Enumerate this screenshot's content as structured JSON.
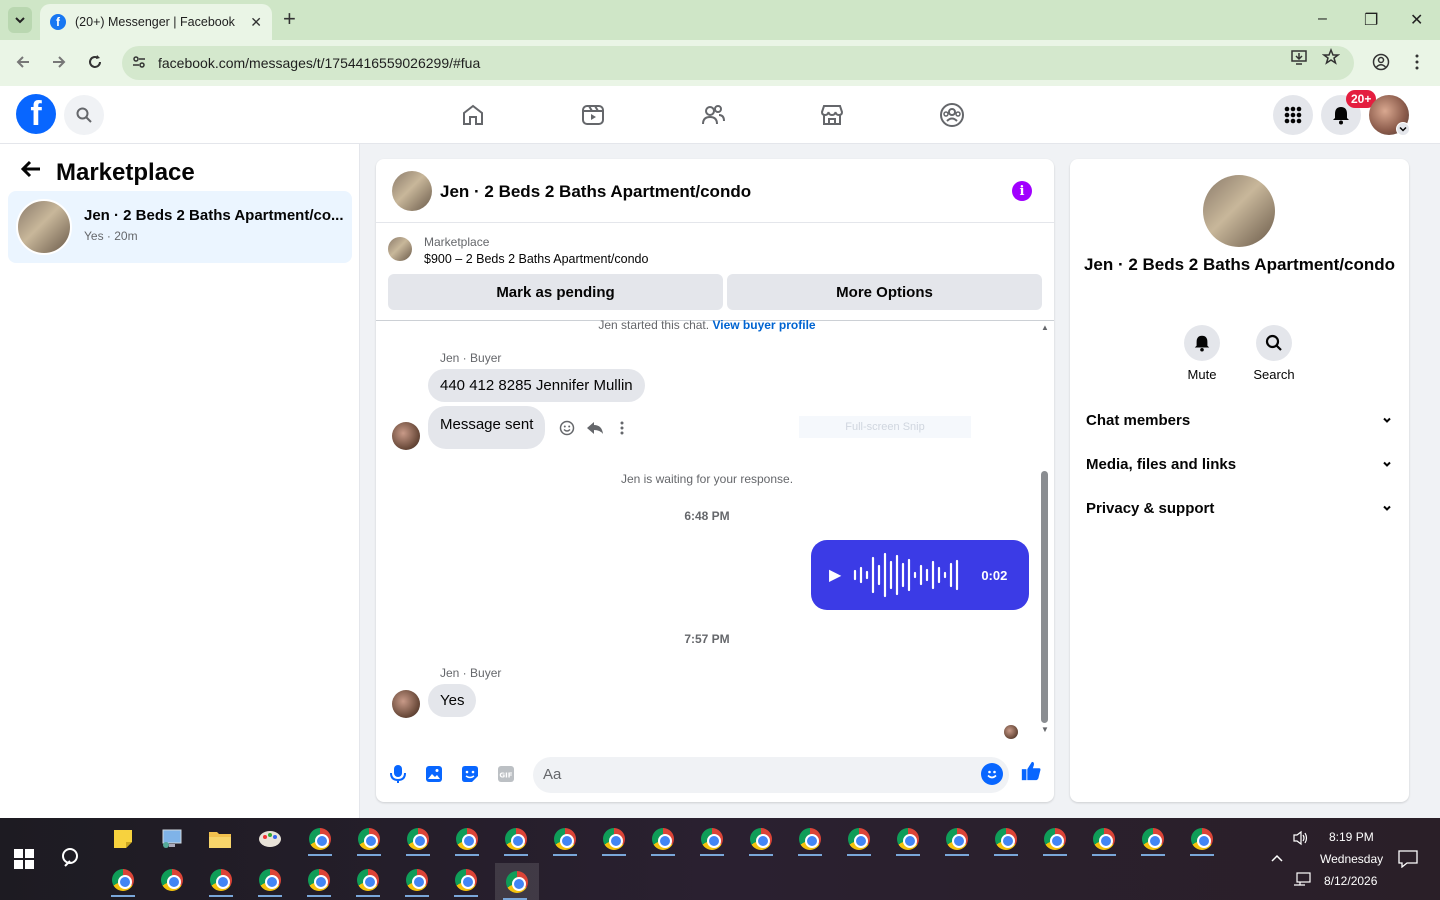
{
  "browser": {
    "tab_title": "(20+) Messenger | Facebook",
    "tab_close": "✕",
    "new_tab": "+",
    "url": "facebook.com/messages/t/1754416559026299/#fua",
    "window_controls": [
      "–",
      "❐",
      "✕"
    ]
  },
  "fb": {
    "notification_badge": "20+",
    "nav_icons": [
      "home-icon",
      "video-icon",
      "friends-icon",
      "marketplace-icon",
      "groups-icon"
    ]
  },
  "left": {
    "title": "Marketplace",
    "conversation": {
      "name": "Jen · 2 Beds 2 Baths Apartment/co...",
      "sub": "Yes · 20m"
    }
  },
  "chat": {
    "title": "Jen · 2 Beds 2 Baths Apartment/condo",
    "listing_label": "Marketplace",
    "listing_price": "$900 – 2 Beds 2 Baths Apartment/condo",
    "btn_pending": "Mark as pending",
    "btn_more": "More Options",
    "started_text": "Jen started this chat.",
    "view_buyer": "View buyer profile",
    "sender1": "Jen · Buyer",
    "msg1": "440 412 8285 Jennifer Mullin",
    "msg2": "Message sent",
    "ghost_text": "Full-screen Snip",
    "waiting": "Jen is waiting for your response.",
    "time1": "6:48 PM",
    "voice_duration": "0:02",
    "time2": "7:57 PM",
    "sender2": "Jen · Buyer",
    "msg3": "Yes",
    "composer_placeholder": "Aa"
  },
  "right": {
    "name": "Jen · 2 Beds 2 Baths Apartment/condo",
    "mute": "Mute",
    "search": "Search",
    "rows": [
      "Chat members",
      "Media, files and links",
      "Privacy & support"
    ]
  },
  "taskbar": {
    "time": "8:19 PM",
    "day": "Wednesday",
    "date": "8/12/2026"
  },
  "colors": {
    "fb_blue": "#0866ff",
    "voice_bubble": "#3b3be6",
    "info_purple": "#a100ff",
    "badge_red": "#e41e3f"
  }
}
